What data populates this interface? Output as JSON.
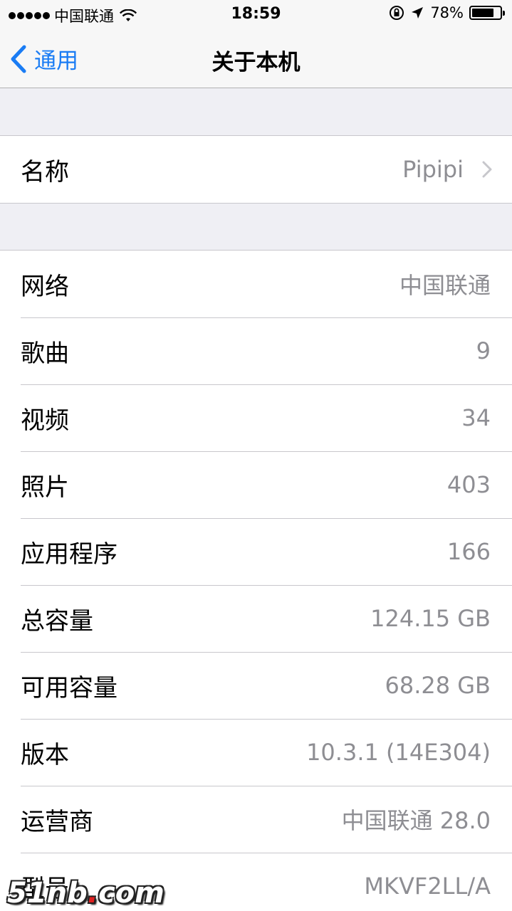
{
  "status_bar": {
    "carrier": "中国联通",
    "time": "18:59",
    "battery_percent": "78%",
    "battery_level": 0.78,
    "signal_bars": 5,
    "icons": [
      "wifi-icon",
      "orientation-lock-icon",
      "location-arrow-icon",
      "battery-icon"
    ]
  },
  "nav": {
    "back_label": "通用",
    "title": "关于本机"
  },
  "name_row": {
    "label": "名称",
    "value": "Pipipi"
  },
  "info_rows": [
    {
      "label": "网络",
      "value": "中国联通"
    },
    {
      "label": "歌曲",
      "value": "9"
    },
    {
      "label": "视频",
      "value": "34"
    },
    {
      "label": "照片",
      "value": "403"
    },
    {
      "label": "应用程序",
      "value": "166"
    },
    {
      "label": "总容量",
      "value": "124.15 GB"
    },
    {
      "label": "可用容量",
      "value": "68.28 GB"
    },
    {
      "label": "版本",
      "value": "10.3.1 (14E304)"
    },
    {
      "label": "运营商",
      "value": "中国联通 28.0"
    },
    {
      "label": "型号",
      "value": "MKVF2LL/A"
    }
  ],
  "watermark": {
    "text_main": "51nb",
    "text_dot": ".",
    "text_tail": "com"
  },
  "colors": {
    "accent": "#1a7cf4",
    "secondary_text": "#8e8e93",
    "background": "#efeff4"
  }
}
